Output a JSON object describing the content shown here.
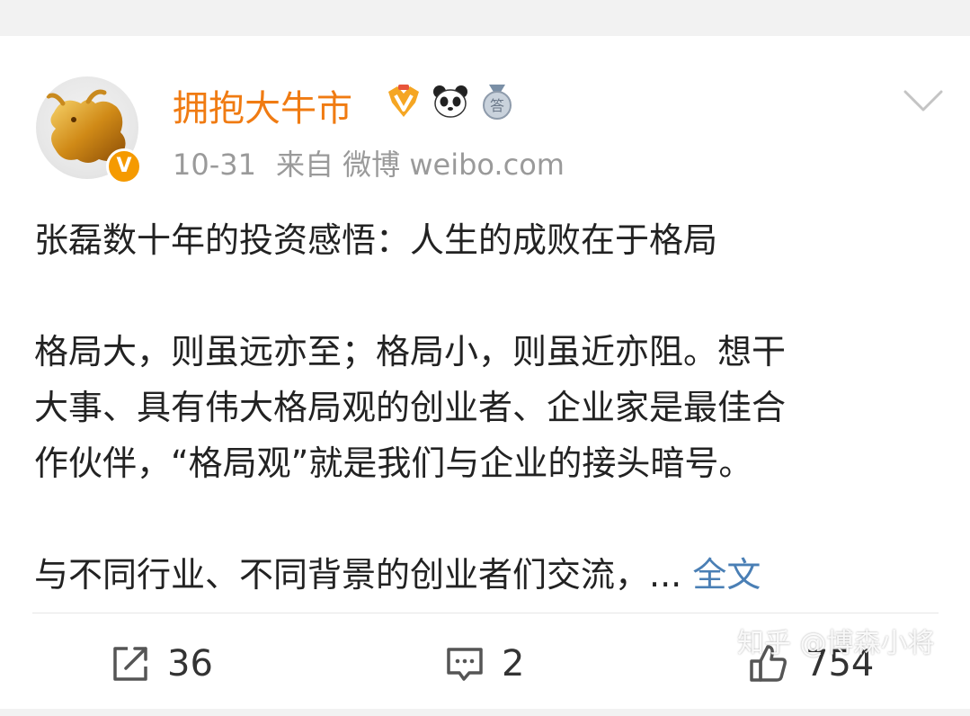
{
  "post": {
    "username": "拥抱大牛市",
    "time": "10-31",
    "source_prefix": "来自",
    "source": "微博 weibo.com",
    "verified_badge": "V",
    "badges": [
      "vip-level-icon",
      "panda-icon",
      "answer-medal-icon"
    ],
    "content": {
      "line1": "张磊数十年的投资感悟：人生的成败在于格局",
      "para2": [
        "格局大，则虽远亦至；格局小，则虽近亦阻。想干",
        "大事、具有伟大格局观的创业者、企业家是最佳合",
        "作伙伴，“格局观”就是我们与企业的接头暗号。"
      ],
      "line4": "与不同行业、不同背景的创业者们交流，...",
      "full_text_link": "全文"
    }
  },
  "actions": {
    "repost_count": "36",
    "comment_count": "2",
    "like_count": "754"
  },
  "watermark": "知乎 @博森小将",
  "colors": {
    "username": "#f07b12",
    "link": "#4a7fb5",
    "meta": "#9a9a9a",
    "badge": "#f59a00"
  }
}
